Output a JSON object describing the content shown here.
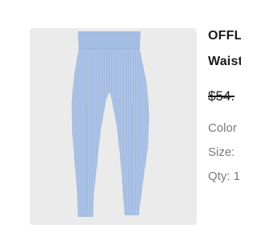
{
  "product": {
    "image_alt": "light blue leggings",
    "colors": {
      "card_bg": "#ebebeb",
      "leggings": "#a9c2e6"
    }
  },
  "details": {
    "brand": "OFFL",
    "subtitle": "Waist",
    "price": "$54.",
    "color_label": "Color",
    "size_label": "Size:",
    "qty_label": "Qty: 1"
  }
}
